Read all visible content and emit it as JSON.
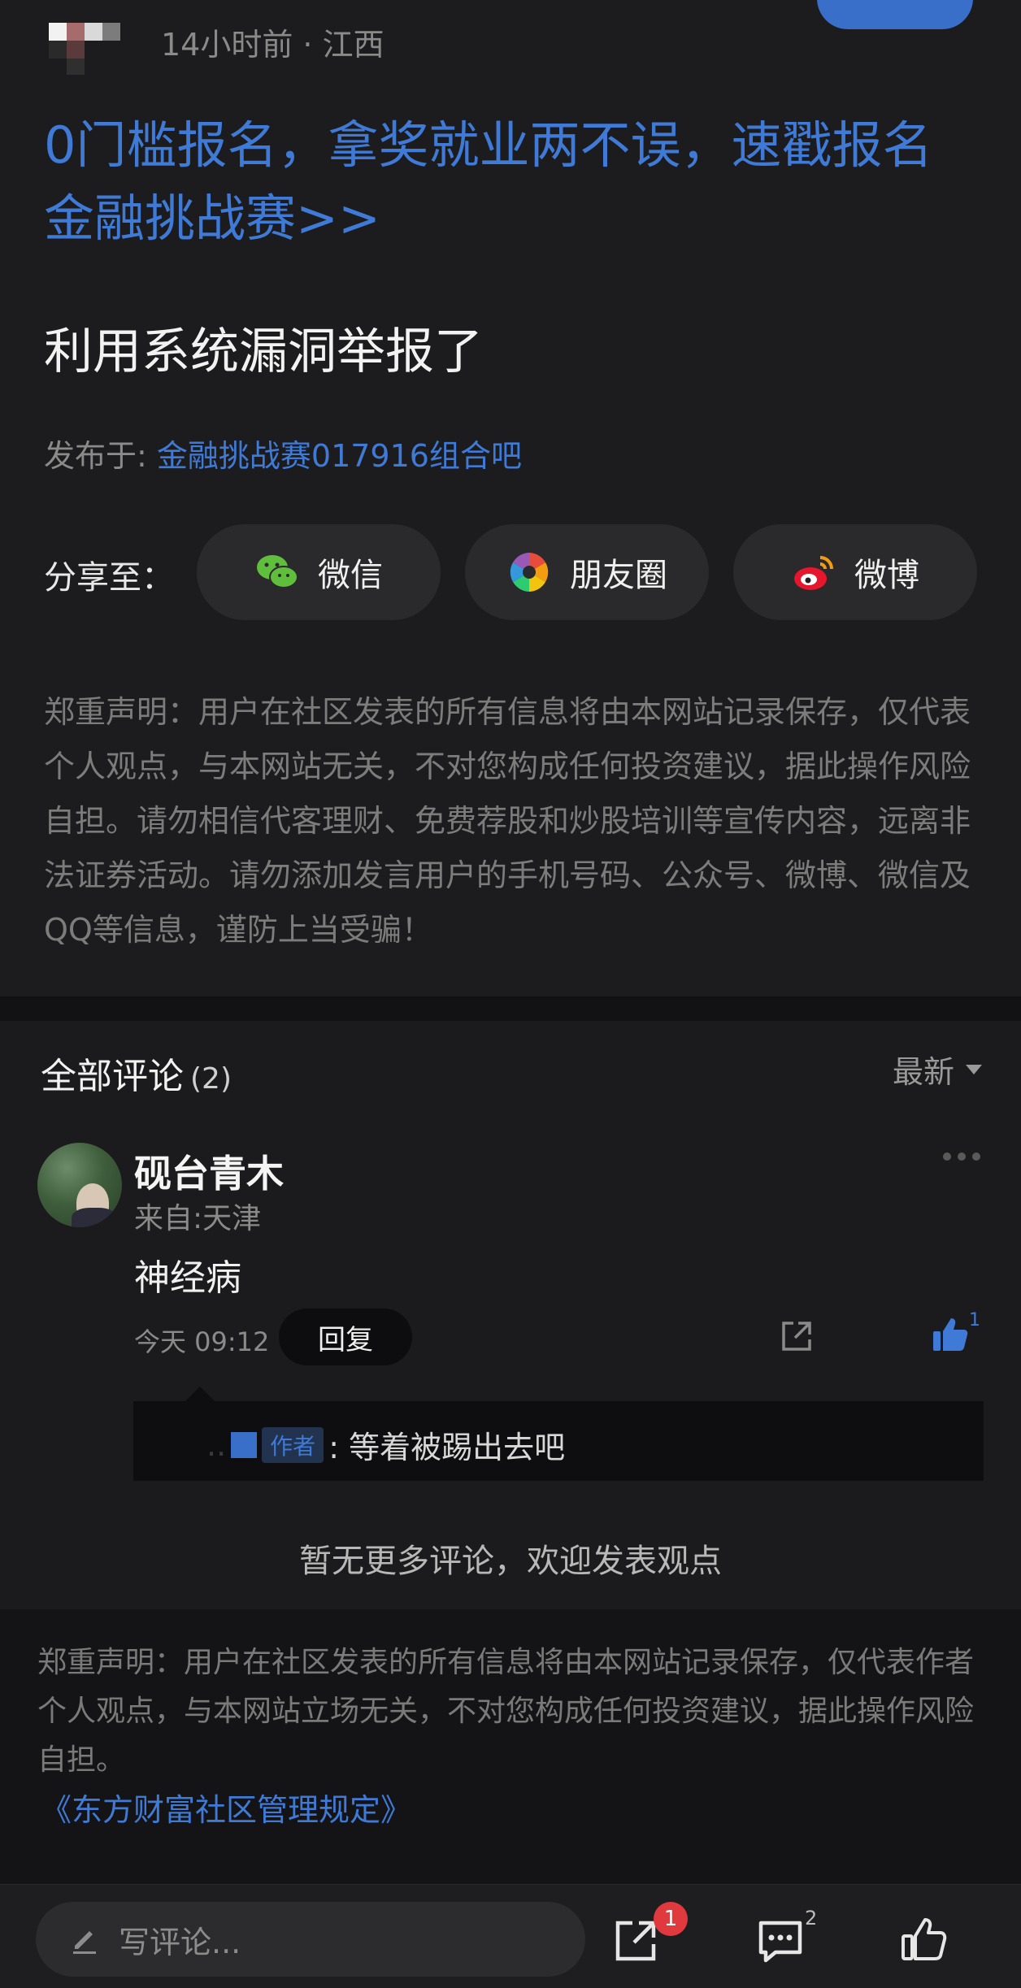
{
  "post": {
    "meta": "14小时前 · 江西",
    "promo_link": "0门槛报名，拿奖就业两不误，速戳报名金融挑战赛>>",
    "title": "利用系统漏洞举报了",
    "published_prefix": "发布于: ",
    "published_bar": "金融挑战赛017916组合吧",
    "share_label": "分享至：",
    "share_options": [
      {
        "label": "微信",
        "icon": "wechat-icon"
      },
      {
        "label": "朋友圈",
        "icon": "moments-icon"
      },
      {
        "label": "微博",
        "icon": "weibo-icon"
      }
    ],
    "disclaimer": "郑重声明：用户在社区发表的所有信息将由本网站记录保存，仅代表个人观点，与本网站无关，不对您构成任何投资建议，据此操作风险自担。请勿相信代客理财、免费荐股和炒股培训等宣传内容，远离非法证券活动。请勿添加发言用户的手机号码、公众号、微博、微信及QQ等信息，谨防上当受骗！"
  },
  "comments": {
    "title": "全部评论",
    "count": "(2)",
    "sort_label": "最新",
    "items": [
      {
        "name": "砚台青木",
        "from": "来自:天津",
        "body": "神经病",
        "time": "今天 09:12",
        "reply_label": "回复",
        "like_count": "1",
        "reply": {
          "author_tag": "作者",
          "text": ": 等着被踢出去吧"
        }
      }
    ],
    "no_more": "暂无更多评论，欢迎发表观点"
  },
  "footer": {
    "disclaimer": "郑重声明：用户在社区发表的所有信息将由本网站记录保存，仅代表作者个人观点，与本网站立场无关，不对您构成任何投资建议，据此操作风险自担。",
    "rules_link": "《东方财富社区管理规定》"
  },
  "bottom_bar": {
    "write_placeholder": "写评论...",
    "share_badge": "1",
    "comment_count": "2"
  },
  "colors": {
    "accent_blue": "#3f7ad6",
    "badge_red": "#e0393e",
    "background": "#1b1b1d"
  }
}
